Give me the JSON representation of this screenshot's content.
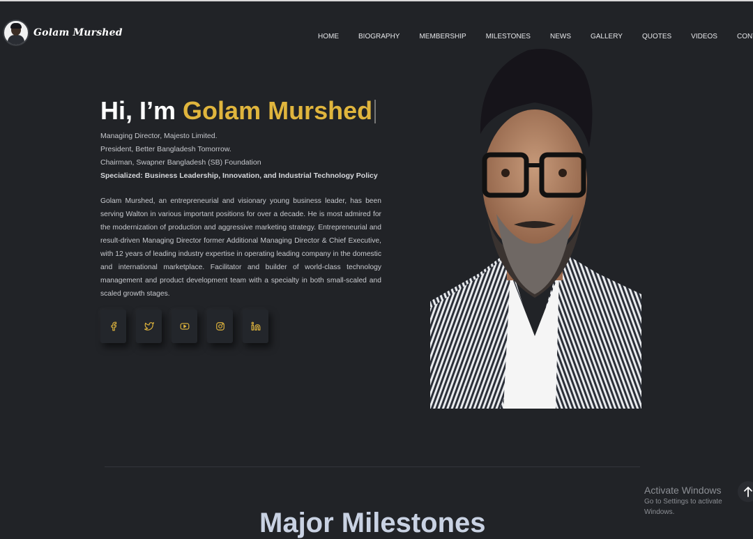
{
  "header": {
    "logo_text": "Golam Murshed",
    "nav": [
      "HOME",
      "BIOGRAPHY",
      "MEMBERSHIP",
      "MILESTONES",
      "NEWS",
      "GALLERY",
      "QUOTES",
      "VIDEOS",
      "CONTACT"
    ]
  },
  "hero": {
    "greeting": "Hi, I’m",
    "name": "Golam Murshed",
    "roles": [
      "Managing Director, Majesto Limited.",
      "President, Better Bangladesh Tomorrow.",
      "Chairman, Swapner Bangladesh (SB) Foundation"
    ],
    "specialized": "Specialized: Business Leadership, Innovation, and Industrial Technology Policy",
    "bio": "Golam Murshed, an entrepreneurial and visionary young business leader, has been serving Walton in various important positions for over a decade. He is most admired for the modernization of production and aggressive marketing strategy. Entrepreneurial and result-driven Managing Director former Additional Managing Director & Chief Executive, with 12 years of leading industry expertise in operating leading company in the domestic and international marketplace. Facilitator and builder of world-class technology management and product development team with a specialty in both small-scaled and scaled growth stages."
  },
  "socials": [
    {
      "icon": "facebook-icon"
    },
    {
      "icon": "twitter-icon"
    },
    {
      "icon": "youtube-icon"
    },
    {
      "icon": "instagram-icon"
    },
    {
      "icon": "linkedin-icon"
    }
  ],
  "milestones": {
    "title": "Major Milestones"
  },
  "windows_overlay": {
    "title": "Activate Windows",
    "subtitle": "Go to Settings to activate Windows."
  },
  "colors": {
    "background": "#212327",
    "accent": "#e0b53d",
    "text": "#c9cbd0"
  }
}
